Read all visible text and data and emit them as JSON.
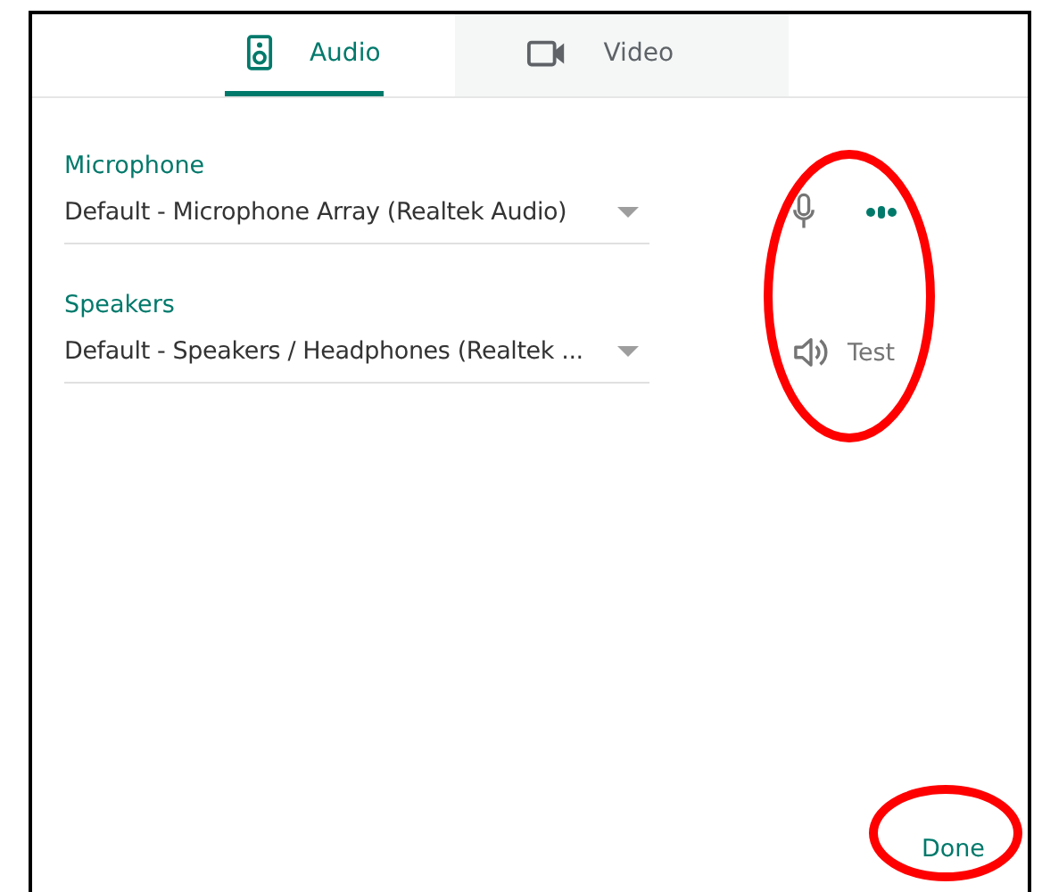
{
  "tabs": [
    {
      "label": "Audio",
      "kind": "audio",
      "selected": true
    },
    {
      "label": "Video",
      "kind": "video",
      "selected": false
    }
  ],
  "devices": [
    {
      "label": "Microphone",
      "value": "Default - Microphone Array (Realtek Audio)",
      "kind": "microphone"
    },
    {
      "label": "Speakers",
      "value": "Default - Speakers / Headphones (Realtek ...",
      "kind": "speakers",
      "action": "Test"
    }
  ],
  "done_button": "Done",
  "annotations": [
    {
      "kind": "ellipse"
    },
    {
      "kind": "ellipse"
    }
  ]
}
